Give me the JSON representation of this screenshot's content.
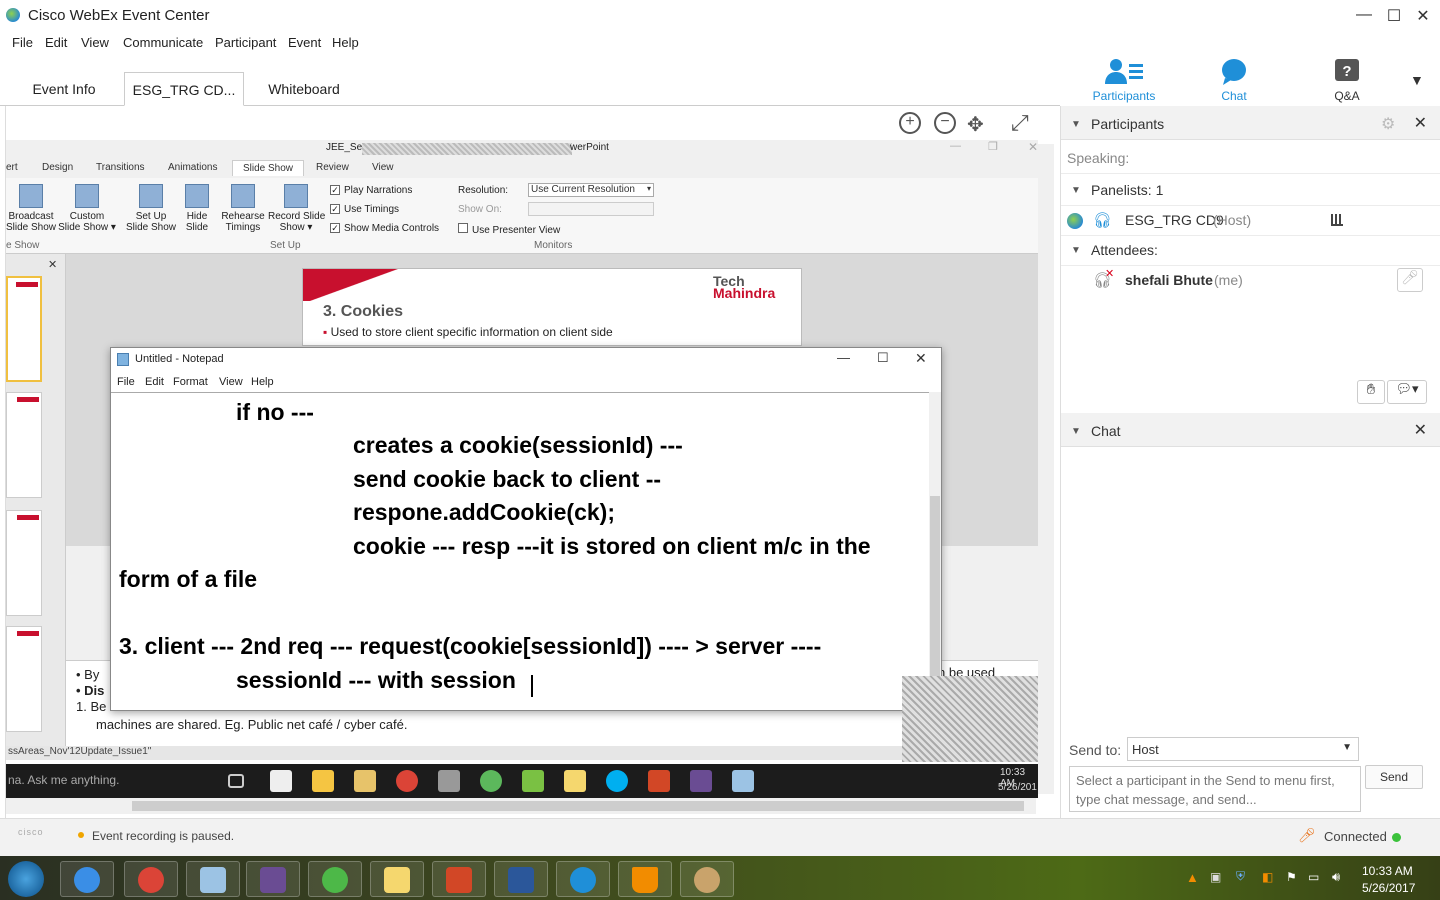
{
  "app": {
    "title": "Cisco WebEx Event Center"
  },
  "window_controls": {
    "minimize": "—",
    "maximize": "☐",
    "close": "✕"
  },
  "menu": [
    "File",
    "Edit",
    "View",
    "Communicate",
    "Participant",
    "Event",
    "Help"
  ],
  "tabs": [
    {
      "label": "Event Info"
    },
    {
      "label": "ESG_TRG CD...",
      "active": true
    },
    {
      "label": "Whiteboard"
    }
  ],
  "top_icons": {
    "participants": "Participants",
    "chat": "Chat",
    "qa": "Q&A"
  },
  "ppt": {
    "title_left": "JEE_Serv",
    "title_right": "werPoint",
    "ribbon_tabs": [
      "ert",
      "Design",
      "Transitions",
      "Animations",
      "Slide Show",
      "Review",
      "View"
    ],
    "buttons": {
      "broadcast": "Broadcast\nSlide Show",
      "custom": "Custom\nSlide Show ▾",
      "setup": "Set Up\nSlide Show",
      "hide": "Hide\nSlide",
      "rehearse": "Rehearse\nTimings",
      "record": "Record Slide\nShow ▾"
    },
    "checks": {
      "narrations": "Play Narrations",
      "timings": "Use Timings",
      "media": "Show Media Controls",
      "presenter": "Use Presenter View"
    },
    "resolution_label": "Resolution:",
    "resolution_value": "Use Current Resolution",
    "show_on_label": "Show On:",
    "groups": {
      "start": "e Show",
      "setup": "Set Up",
      "monitors": "Monitors"
    },
    "slide": {
      "heading": "3. Cookies",
      "bullet": "Used to store client specific information on client side",
      "logo_top": "Tech",
      "logo_bottom": "Mahindra"
    },
    "notes": {
      "l1": "By",
      "l2": "Dis",
      "l3": "1.  Be",
      "l4": "machines are shared. Eg. Public net café  / cyber café.",
      "right": "n be used"
    },
    "status": "ssAreas_Nov'12Update_Issue1\"",
    "search_text": "na. Ask me anything.",
    "clock_time": "10:33 AM",
    "clock_date": "5/26/201"
  },
  "notepad": {
    "title": "Untitled - Notepad",
    "menu": [
      "File",
      "Edit",
      "Format",
      "View",
      "Help"
    ],
    "lines": [
      "if no ---",
      "creates a cookie(sessionId) ---",
      "send cookie back to client --",
      "respone.addCookie(ck);",
      "cookie --- resp ---it is stored on client m/c in the",
      "form of a file",
      "3. client --- 2nd req --- request(cookie[sessionId]) ---- > server ----",
      "sessionId --- with session"
    ]
  },
  "panel": {
    "participants_title": "Participants",
    "speaking": "Speaking:",
    "panelists": "Panelists: 1",
    "host_name": "ESG_TRG CD9",
    "host_tag": "(Host)",
    "attendees": "Attendees:",
    "me_name": "shefali Bhute",
    "me_tag": "(me)",
    "chat_title": "Chat",
    "send_to_label": "Send to:",
    "send_to_value": "Host",
    "chat_placeholder": "Select a participant in the Send to menu first, type chat message, and send...",
    "send_button": "Send"
  },
  "status": {
    "recording": "Event recording is paused.",
    "connected": "Connected",
    "brand": "cisco"
  },
  "os_clock": {
    "time": "10:33 AM",
    "date": "5/26/2017"
  },
  "colors": {
    "accent": "#1f8fd8",
    "green_dot": "#3bc23b",
    "recording_dot": "#f0a500",
    "brand_red": "#c8102e"
  }
}
